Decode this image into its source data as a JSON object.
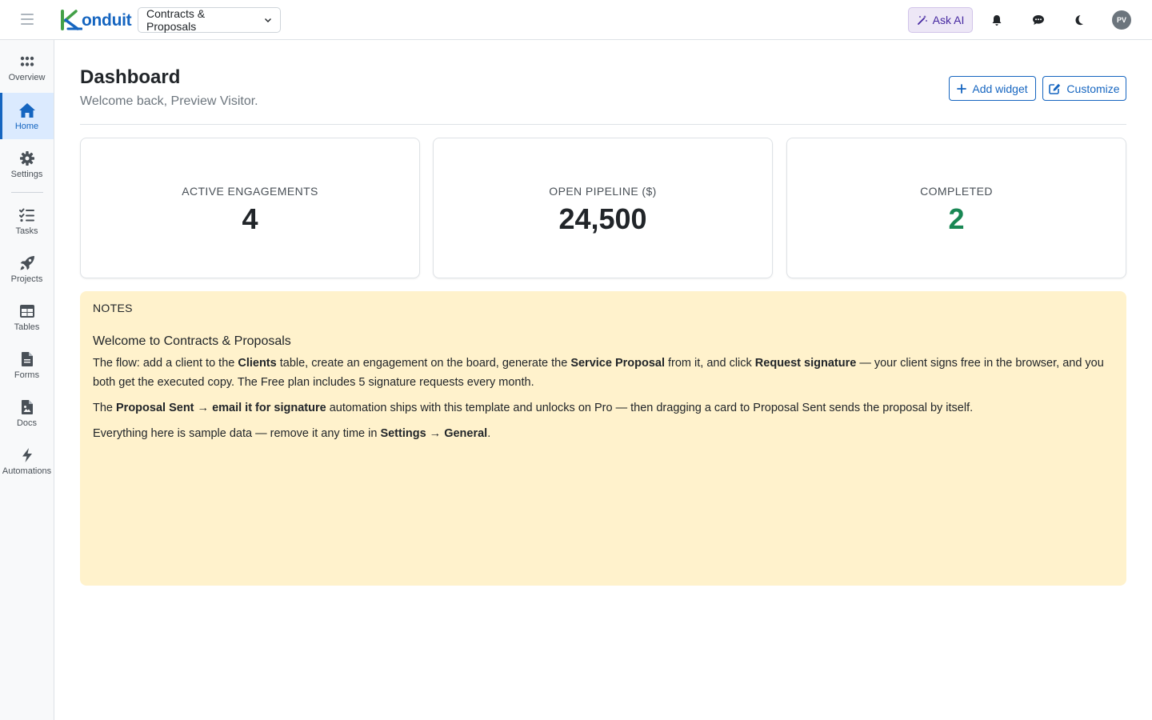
{
  "topbar": {
    "brand_rest": "onduit",
    "workspace": "Contracts & Proposals",
    "ask_ai": "Ask AI",
    "avatar_initials": "PV"
  },
  "sidebar": {
    "items": [
      {
        "label": "Overview",
        "icon": "grid-icon"
      },
      {
        "label": "Home",
        "icon": "home-icon",
        "active": true
      },
      {
        "label": "Settings",
        "icon": "gear-icon"
      },
      {
        "label": "Tasks",
        "icon": "checklist-icon"
      },
      {
        "label": "Projects",
        "icon": "rocket-icon"
      },
      {
        "label": "Tables",
        "icon": "table-icon"
      },
      {
        "label": "Forms",
        "icon": "form-icon"
      },
      {
        "label": "Docs",
        "icon": "doc-icon"
      },
      {
        "label": "Automations",
        "icon": "bolt-icon"
      }
    ]
  },
  "header": {
    "title": "Dashboard",
    "subtitle": "Welcome back, Preview Visitor.",
    "add_widget": "Add widget",
    "customize": "Customize"
  },
  "stats": [
    {
      "label": "ACTIVE ENGAGEMENTS",
      "value": "4"
    },
    {
      "label": "OPEN PIPELINE ($)",
      "value": "24,500"
    },
    {
      "label": "COMPLETED",
      "value": "2"
    }
  ],
  "notes": {
    "label": "NOTES",
    "heading": "Welcome to Contracts & Proposals",
    "p1": {
      "a": "The flow: add a client to the ",
      "b1": "Clients",
      "c": " table, create an engagement on the board, generate the ",
      "b2": "Service Proposal",
      "d": " from it, and click ",
      "b3": "Request signature",
      "e": " — your client signs free in the browser, and you both get the executed copy. The Free plan includes 5 signature requests every month."
    },
    "p2": {
      "a": "The ",
      "b1": "Proposal Sent → email it for signature",
      "c": " automation ships with this template and unlocks on Pro — then dragging a card to Proposal Sent sends the proposal by itself."
    },
    "p3": {
      "a": "Everything here is sample data — remove it any time in ",
      "b1": "Settings → General",
      "c": "."
    }
  },
  "colors": {
    "brand": "#1565c0",
    "logo_green": "#43a047",
    "notes_bg": "#fff2cc",
    "completed_green": "#198754"
  }
}
